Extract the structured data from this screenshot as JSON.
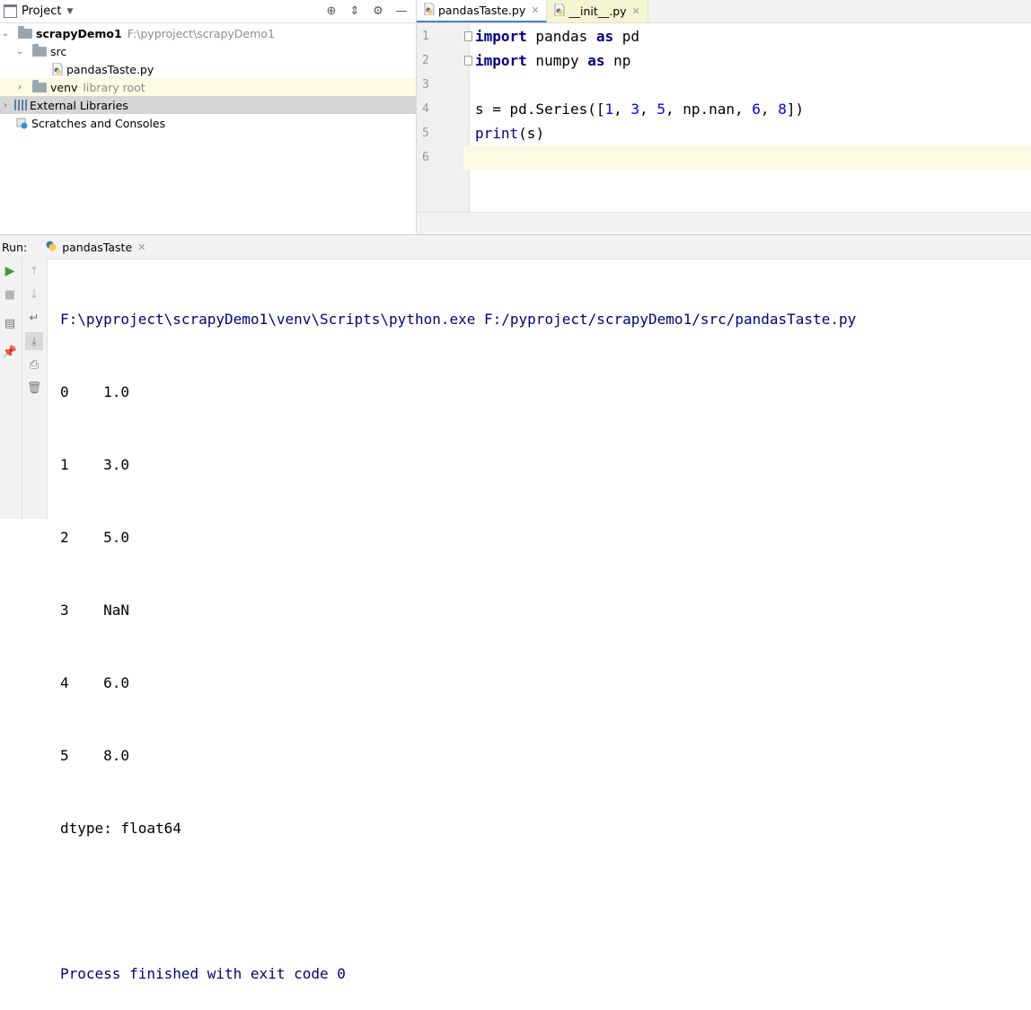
{
  "project": {
    "title": "Project",
    "tree": {
      "root_name": "scrapyDemo1",
      "root_path": "F:\\pyproject\\scrapyDemo1",
      "src": "src",
      "file": "pandasTaste.py",
      "venv": "venv",
      "venv_hint": "library root",
      "ext_libs": "External Libraries",
      "scratches": "Scratches and Consoles"
    }
  },
  "editor": {
    "tabs": [
      {
        "label": "pandasTaste.py"
      },
      {
        "label": "__init__.py"
      }
    ],
    "line_numbers": [
      "1",
      "2",
      "3",
      "4",
      "5",
      "6"
    ],
    "code": {
      "l1_kw1": "import",
      "l1_mod": " pandas ",
      "l1_kw2": "as",
      "l1_alias": " pd",
      "l2_kw1": "import",
      "l2_mod": " numpy ",
      "l2_kw2": "as",
      "l2_alias": " np",
      "l4_a": "s = pd.Series([",
      "l4_n1": "1",
      "l4_c1": ", ",
      "l4_n2": "3",
      "l4_c2": ", ",
      "l4_n3": "5",
      "l4_b": ", np.nan, ",
      "l4_n4": "6",
      "l4_c3": ", ",
      "l4_n5": "8",
      "l4_end": "])",
      "l5_fn": "print",
      "l5_rest": "(s)"
    }
  },
  "run": {
    "label": "Run:",
    "tab": "pandasTaste",
    "output": [
      "F:\\pyproject\\scrapyDemo1\\venv\\Scripts\\python.exe F:/pyproject/scrapyDemo1/src/pandasTaste.py",
      "0    1.0",
      "1    3.0",
      "2    5.0",
      "3    NaN",
      "4    6.0",
      "5    8.0",
      "dtype: float64",
      "",
      "Process finished with exit code 0"
    ]
  },
  "colors": {
    "keyword": "#000080",
    "number": "#0000ff",
    "current_line": "#fcfae1",
    "tab_accent": "#4083c9"
  }
}
